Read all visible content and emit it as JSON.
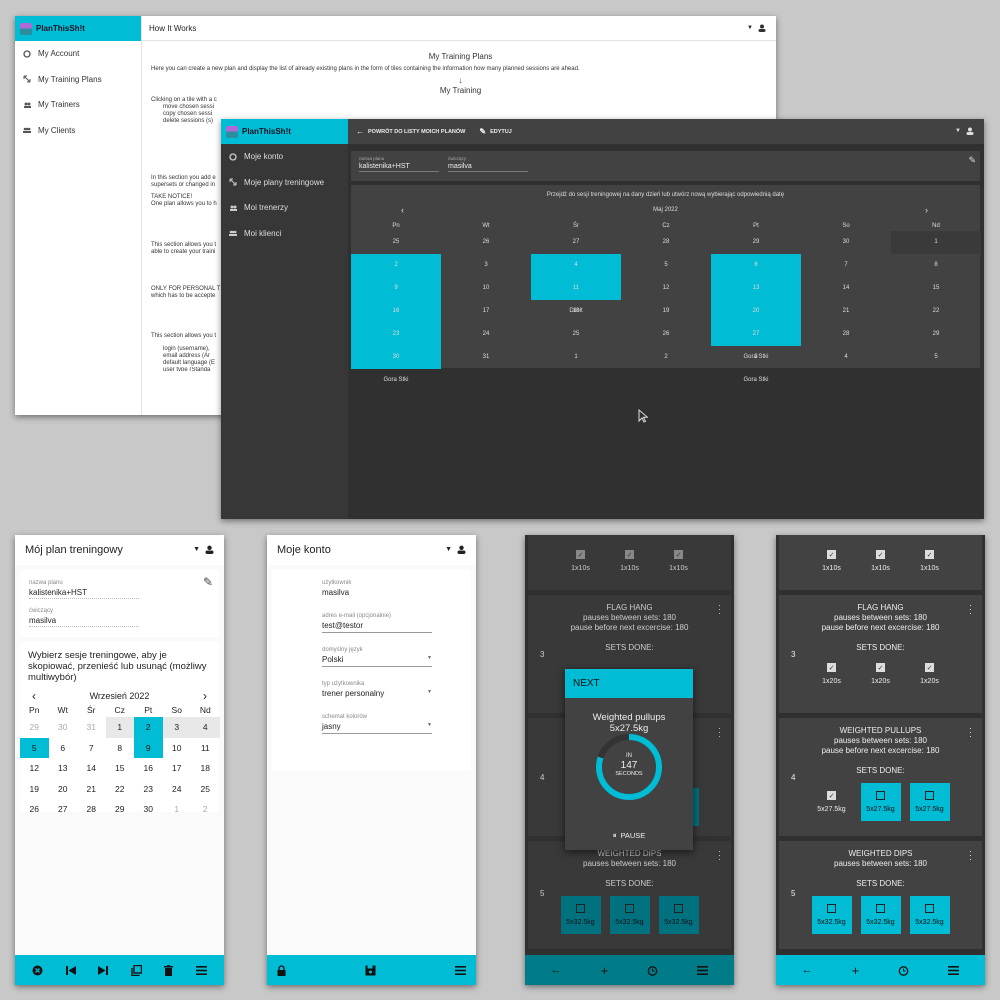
{
  "w1": {
    "brand": "PlanThisSh!t",
    "title": "How It Works",
    "nav": [
      "My Account",
      "My Training Plans",
      "My Trainers",
      "My Clients"
    ],
    "h1": "My Training Plans",
    "p1": "Here you can create a new plan and display the list of already existing plans in the form of tiles containing the information how many planned sessions are ahead.",
    "arrow": "↓",
    "h2": "My Training",
    "l1": "Clicking on a tile with a c",
    "b1": "move chosen sessi",
    "b2": "copy chosen sessi",
    "b3": "delete sessions (s)",
    "l2": "In this section you add e",
    "l3": "supersets or changed in",
    "l4": "TAKE NOTICE!",
    "l5": "One plan allows you to h",
    "l6": "This section allows you t",
    "l7": "able to create your traini",
    "l8": "ONLY FOR PERSONAL TR",
    "l9": "which has to be accepte",
    "l10": "This section allows you t",
    "b4": "login (username),",
    "b5": "email address (Ar",
    "b6": "default language (E",
    "b7": "user type (Standa"
  },
  "w2": {
    "brand": "PlanThisSh!t",
    "back": "POWRÓT DO LISTY MOICH PLANÓW",
    "edit": "EDYTUJ",
    "nav": [
      "Moje konto",
      "Moje plany treningowe",
      "Moi trenerzy",
      "Moi klienci"
    ],
    "plan_label": "nazwa planu",
    "plan": "kalistenika+HST",
    "trainee_label": "ćwiczący",
    "trainee": "masilva",
    "msg": "Przejdź do sesji treningowej na dany dzień lub utwórz nową wybierając odpowiednią datę",
    "month": "Maj 2022",
    "prev": "‹",
    "next": "›",
    "days": [
      "Pn",
      "Wt",
      "Śr",
      "Cz",
      "Pt",
      "So",
      "Nd"
    ],
    "cells": [
      {
        "d": "25",
        "t": "",
        "k": "mut"
      },
      {
        "d": "26",
        "t": "",
        "k": "mut"
      },
      {
        "d": "27",
        "t": "",
        "k": "mut"
      },
      {
        "d": "28",
        "t": "",
        "k": "mut"
      },
      {
        "d": "29",
        "t": "",
        "k": "mut"
      },
      {
        "d": "30",
        "t": "",
        "k": "mut"
      },
      {
        "d": "1",
        "t": "",
        "k": ""
      },
      {
        "d": "2",
        "t": "Gora",
        "k": "sel"
      },
      {
        "d": "3",
        "t": "",
        "k": ""
      },
      {
        "d": "4",
        "t": "Gry",
        "k": "sel"
      },
      {
        "d": "5",
        "t": "",
        "k": ""
      },
      {
        "d": "6",
        "t": "Gora",
        "k": "sel"
      },
      {
        "d": "7",
        "t": "",
        "k": ""
      },
      {
        "d": "8",
        "t": "",
        "k": ""
      },
      {
        "d": "9",
        "t": "Dilolt",
        "k": "sel"
      },
      {
        "d": "10",
        "t": "",
        "k": ""
      },
      {
        "d": "11",
        "t": "Dilolt",
        "k": "sel"
      },
      {
        "d": "12",
        "t": "",
        "k": ""
      },
      {
        "d": "13",
        "t": "Dilolt",
        "k": "sel"
      },
      {
        "d": "14",
        "t": "",
        "k": ""
      },
      {
        "d": "15",
        "t": "",
        "k": ""
      },
      {
        "d": "16",
        "t": "Gora Stki",
        "k": "sel"
      },
      {
        "d": "17",
        "t": "",
        "k": ""
      },
      {
        "d": "18",
        "t": "",
        "k": ""
      },
      {
        "d": "19",
        "t": "",
        "k": ""
      },
      {
        "d": "20",
        "t": "Gora Stki",
        "k": "sel"
      },
      {
        "d": "21",
        "t": "",
        "k": ""
      },
      {
        "d": "22",
        "t": "",
        "k": ""
      },
      {
        "d": "23",
        "t": "Gora Stki",
        "k": "sel"
      },
      {
        "d": "24",
        "t": "",
        "k": ""
      },
      {
        "d": "25",
        "t": "",
        "k": ""
      },
      {
        "d": "26",
        "t": "",
        "k": ""
      },
      {
        "d": "27",
        "t": "Gora Stki",
        "k": "sel"
      },
      {
        "d": "28",
        "t": "",
        "k": ""
      },
      {
        "d": "29",
        "t": "",
        "k": ""
      },
      {
        "d": "30",
        "t": "Gora Stki",
        "k": "sel"
      },
      {
        "d": "31",
        "t": "",
        "k": ""
      },
      {
        "d": "1",
        "t": "",
        "k": "mut"
      },
      {
        "d": "2",
        "t": "",
        "k": "mut"
      },
      {
        "d": "3",
        "t": "Gora Stki",
        "k": "mut"
      },
      {
        "d": "4",
        "t": "",
        "k": "mut"
      },
      {
        "d": "5",
        "t": "",
        "k": "mut"
      }
    ]
  },
  "p1": {
    "title": "Mój plan treningowy",
    "plan_label": "nazwa planu",
    "plan": "kalistenika+HST",
    "trainee_label": "ćwiczący",
    "trainee": "masilva",
    "msg": "Wybierz sesje treningowe, aby je skopiować, przenieść lub usunąć (możliwy multiwybór)",
    "month": "Wrzesień 2022",
    "prev": "‹",
    "next": "›",
    "days": [
      "Pn",
      "Wt",
      "Śr",
      "Cz",
      "Pt",
      "So",
      "Nd"
    ],
    "cells": [
      {
        "d": "29",
        "k": "mut"
      },
      {
        "d": "30",
        "k": "mut"
      },
      {
        "d": "31",
        "k": "mut"
      },
      {
        "d": "1",
        "k": "gry"
      },
      {
        "d": "2",
        "k": "sel"
      },
      {
        "d": "3",
        "k": "gry"
      },
      {
        "d": "4",
        "k": "gry"
      },
      {
        "d": "5",
        "k": "sel"
      },
      {
        "d": "6",
        "k": ""
      },
      {
        "d": "7",
        "k": ""
      },
      {
        "d": "8",
        "k": ""
      },
      {
        "d": "9",
        "k": "sel"
      },
      {
        "d": "10",
        "k": ""
      },
      {
        "d": "11",
        "k": ""
      },
      {
        "d": "12",
        "k": ""
      },
      {
        "d": "13",
        "k": ""
      },
      {
        "d": "14",
        "k": ""
      },
      {
        "d": "15",
        "k": ""
      },
      {
        "d": "16",
        "k": ""
      },
      {
        "d": "17",
        "k": ""
      },
      {
        "d": "18",
        "k": ""
      },
      {
        "d": "19",
        "k": ""
      },
      {
        "d": "20",
        "k": ""
      },
      {
        "d": "21",
        "k": ""
      },
      {
        "d": "22",
        "k": ""
      },
      {
        "d": "23",
        "k": ""
      },
      {
        "d": "24",
        "k": ""
      },
      {
        "d": "25",
        "k": ""
      },
      {
        "d": "26",
        "k": ""
      },
      {
        "d": "27",
        "k": ""
      },
      {
        "d": "28",
        "k": ""
      },
      {
        "d": "29",
        "k": ""
      },
      {
        "d": "30",
        "k": ""
      },
      {
        "d": "1",
        "k": "mut"
      },
      {
        "d": "2",
        "k": "mut"
      }
    ]
  },
  "p2": {
    "title": "Moje konto",
    "user_label": "użytkownik",
    "user": "masilva",
    "email_label": "adres e-mail (opcjonalnie)",
    "email": "test@testor",
    "lang_label": "domyślny język",
    "lang": "Polski",
    "type_label": "typ użytkownika",
    "type": "trener personalny",
    "scheme_label": "schemat kolorów",
    "scheme": "jasny"
  },
  "p3": {
    "top": [
      "1x10s",
      "1x10s",
      "1x10s"
    ],
    "ex1": "FLAG HANG",
    "ex1p1": "pauses between sets: 180",
    "ex1p2": "pause before next excercise: 180",
    "sets_done": "SETS DONE:",
    "n3": "3",
    "n4": "4",
    "n5": "5",
    "ex3": "WEIGHTED DIPS",
    "ex3p1": "pauses between sets: 180",
    "w3": [
      "5x32.5kg",
      "5x32.5kg",
      "5x32.5kg"
    ],
    "modal": {
      "head": "NEXT",
      "ex": "Weighted pullups",
      "load": "5x27.5kg",
      "in": "IN",
      "secs": "147",
      "unit": "SECONDS",
      "pause": "PAUSE",
      "progress": 0.8
    }
  },
  "p4": {
    "top": [
      "1x10s",
      "1x10s",
      "1x10s"
    ],
    "ex1": "FLAG HANG",
    "ex1p1": "pauses between sets: 180",
    "ex1p2": "pause before next excercise: 180",
    "sets_done": "SETS DONE:",
    "w1": [
      "1x20s",
      "1x20s",
      "1x20s"
    ],
    "n3": "3",
    "n4": "4",
    "n5": "5",
    "ex2": "WEIGHTED PULLUPS",
    "ex2p1": "pauses between sets: 180",
    "ex2p2": "pause before next excercise: 180",
    "w2": [
      "5x27.5kg",
      "5x27.5kg",
      "5x27.5kg"
    ],
    "ex3": "WEIGHTED DIPS",
    "ex3p1": "pauses between sets: 180",
    "w3": [
      "5x32.5kg",
      "5x32.5kg",
      "5x32.5kg"
    ]
  },
  "colors": {
    "accent": "#00bcd4",
    "dark_bg": "#303030",
    "card_dark": "#424242"
  }
}
